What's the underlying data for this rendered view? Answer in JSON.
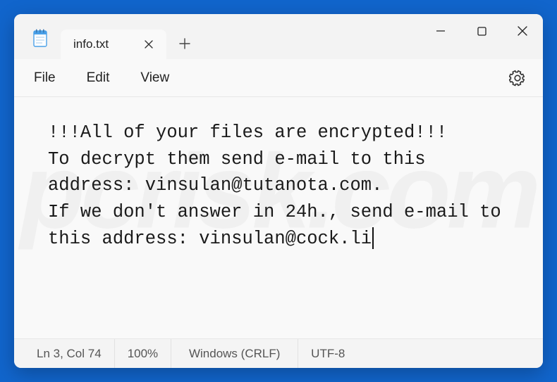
{
  "tab": {
    "title": "info.txt"
  },
  "menu": {
    "file": "File",
    "edit": "Edit",
    "view": "View"
  },
  "content": "!!!All of your files are encrypted!!!\nTo decrypt them send e-mail to this address: vinsulan@tutanota.com.\nIf we don't answer in 24h., send e-mail to this address: vinsulan@cock.li",
  "status": {
    "position": "Ln 3, Col 74",
    "zoom": "100%",
    "eol": "Windows (CRLF)",
    "encoding": "UTF-8"
  }
}
